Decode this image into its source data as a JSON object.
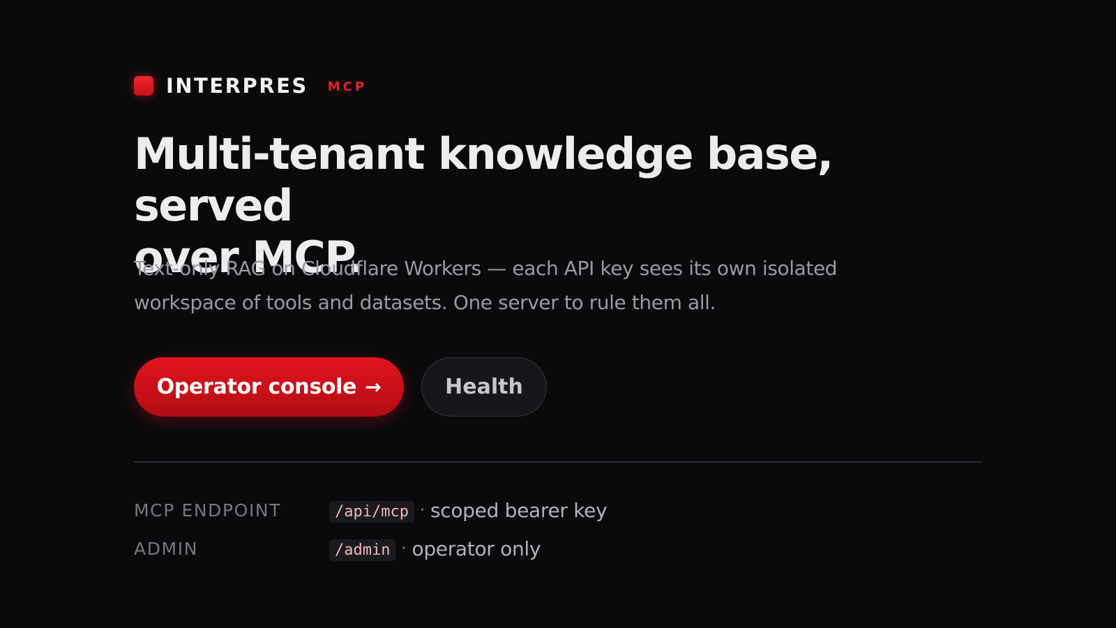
{
  "brand": {
    "name": "INTERPRES",
    "tag": "MCP",
    "accent_color": "#e8202a"
  },
  "hero": {
    "headline_line1": "Multi-tenant knowledge base, served",
    "headline_line2": "over MCP.",
    "subtitle_line1": "Text-only RAG on Cloudflare Workers — each API key sees its own isolated",
    "subtitle_line2": "workspace of tools and datasets. One server to rule them all."
  },
  "actions": {
    "primary_label": "Operator console",
    "primary_arrow": "→",
    "secondary_label": "Health"
  },
  "info": [
    {
      "label": "MCP ENDPOINT",
      "code": "/api/mcp",
      "separator": "·",
      "description": "scoped bearer key"
    },
    {
      "label": "ADMIN",
      "code": "/admin",
      "separator": "·",
      "description": "operator only"
    }
  ]
}
